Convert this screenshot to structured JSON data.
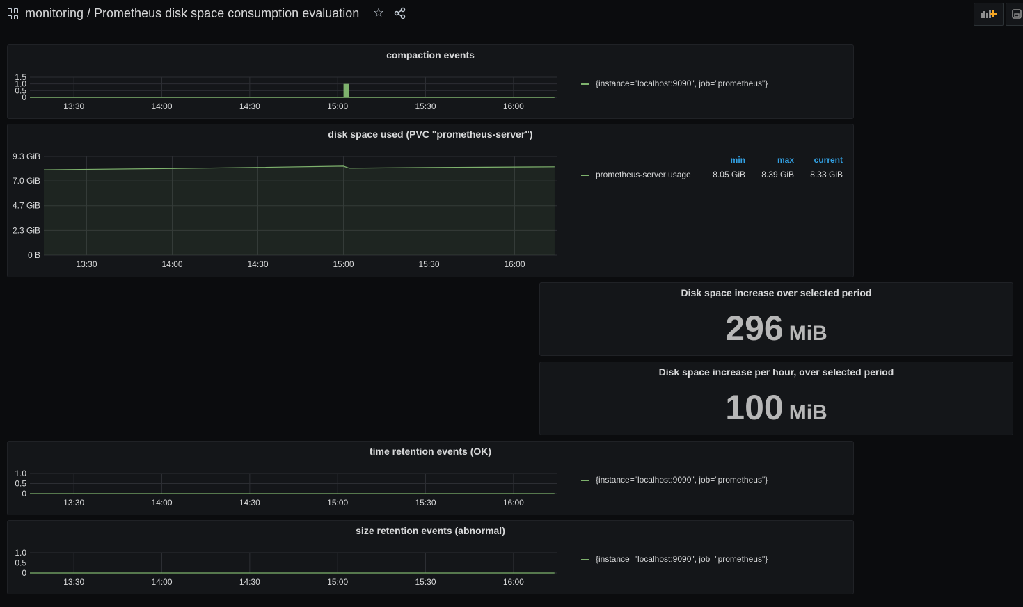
{
  "header": {
    "title": "monitoring / Prometheus disk space consumption evaluation"
  },
  "colors": {
    "series": "#7eb26d",
    "legend_head": "#33a2e5",
    "add_panel_accent": "#f5a623"
  },
  "panels": {
    "compaction": {
      "title": "compaction events",
      "legend": "{instance=\"localhost:9090\", job=\"prometheus\"}"
    },
    "disk": {
      "title": "disk space used (PVC \"prometheus-server\")",
      "legend": "prometheus-server usage",
      "legend_headers": {
        "min": "min",
        "max": "max",
        "current": "current"
      },
      "legend_values": {
        "min": "8.05 GiB",
        "max": "8.39 GiB",
        "current": "8.33 GiB"
      }
    },
    "increase": {
      "title": "Disk space increase over selected period",
      "value": "296",
      "unit": "MiB"
    },
    "increase_hour": {
      "title": "Disk space increase per hour, over selected period",
      "value": "100",
      "unit": "MiB"
    },
    "time_retention": {
      "title": "time retention events (OK)",
      "legend": "{instance=\"localhost:9090\", job=\"prometheus\"}"
    },
    "size_retention": {
      "title": "size retention events (abnormal)",
      "legend": "{instance=\"localhost:9090\", job=\"prometheus\"}"
    }
  },
  "chart_data": [
    {
      "id": "compaction",
      "type": "bar",
      "xlim": [
        795,
        975
      ],
      "ylim": [
        0,
        1.5
      ],
      "x_ticks": [
        "13:30",
        "14:00",
        "14:30",
        "15:00",
        "15:30",
        "16:00"
      ],
      "x_tick_values": [
        810,
        840,
        870,
        900,
        930,
        960
      ],
      "y_ticks": [
        "0",
        "0.5",
        "1.0",
        "1.5"
      ],
      "y_tick_values": [
        0,
        0.5,
        1.0,
        1.5
      ],
      "baseline_range": [
        795,
        974
      ],
      "bars": [
        {
          "x": 902,
          "width": 2,
          "y": 1
        }
      ]
    },
    {
      "id": "disk",
      "type": "area",
      "xlim": [
        795,
        975
      ],
      "ylim": [
        0,
        9.3
      ],
      "x_ticks": [
        "13:30",
        "14:00",
        "14:30",
        "15:00",
        "15:30",
        "16:00"
      ],
      "x_tick_values": [
        810,
        840,
        870,
        900,
        930,
        960
      ],
      "y_ticks": [
        "0 B",
        "2.3 GiB",
        "4.7 GiB",
        "7.0 GiB",
        "9.3 GiB"
      ],
      "y_tick_values": [
        0,
        2.33,
        4.67,
        7.0,
        9.3
      ],
      "x": [
        795,
        840,
        870,
        900,
        902,
        930,
        960,
        974
      ],
      "y": [
        8.05,
        8.17,
        8.27,
        8.39,
        8.2,
        8.26,
        8.31,
        8.33
      ]
    },
    {
      "id": "time_retention",
      "type": "line",
      "xlim": [
        795,
        975
      ],
      "ylim": [
        0,
        1.0
      ],
      "x_ticks": [
        "13:30",
        "14:00",
        "14:30",
        "15:00",
        "15:30",
        "16:00"
      ],
      "x_tick_values": [
        810,
        840,
        870,
        900,
        930,
        960
      ],
      "y_ticks": [
        "0",
        "0.5",
        "1.0"
      ],
      "y_tick_values": [
        0,
        0.5,
        1.0
      ],
      "x": [
        795,
        974
      ],
      "y": [
        0,
        0
      ]
    },
    {
      "id": "size_retention",
      "type": "line",
      "xlim": [
        795,
        975
      ],
      "ylim": [
        0,
        1.0
      ],
      "x_ticks": [
        "13:30",
        "14:00",
        "14:30",
        "15:00",
        "15:30",
        "16:00"
      ],
      "x_tick_values": [
        810,
        840,
        870,
        900,
        930,
        960
      ],
      "y_ticks": [
        "0",
        "0.5",
        "1.0"
      ],
      "y_tick_values": [
        0,
        0.5,
        1.0
      ],
      "x": [
        795,
        974
      ],
      "y": [
        0,
        0
      ]
    }
  ]
}
